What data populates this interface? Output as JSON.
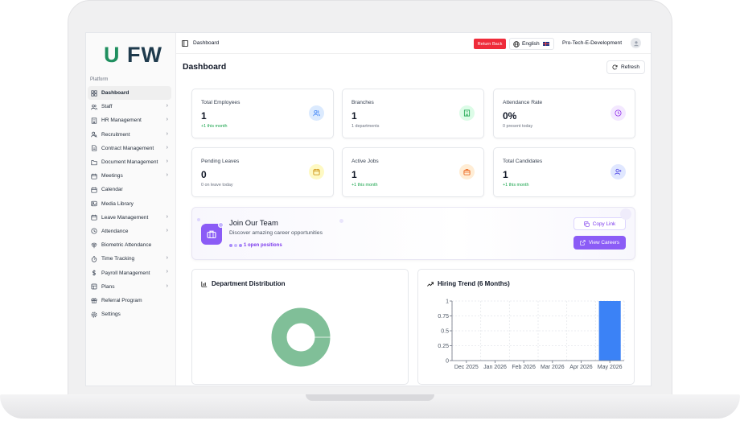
{
  "sidebar": {
    "logo_u": "U",
    "logo_fw": "FW",
    "section_label": "Platform",
    "items": [
      {
        "label": "Dashboard",
        "icon": "grid-icon",
        "chevron": false
      },
      {
        "label": "Staff",
        "icon": "users-icon",
        "chevron": true
      },
      {
        "label": "HR Management",
        "icon": "building-icon",
        "chevron": true
      },
      {
        "label": "Recruitment",
        "icon": "user-search-icon",
        "chevron": true
      },
      {
        "label": "Contract Management",
        "icon": "file-icon",
        "chevron": true
      },
      {
        "label": "Document Management",
        "icon": "folder-icon",
        "chevron": true
      },
      {
        "label": "Meetings",
        "icon": "calendar-icon",
        "chevron": true
      },
      {
        "label": "Calendar",
        "icon": "calendar-icon",
        "chevron": false
      },
      {
        "label": "Media Library",
        "icon": "image-icon",
        "chevron": false
      },
      {
        "label": "Leave Management",
        "icon": "calendar-icon",
        "chevron": true
      },
      {
        "label": "Attendance",
        "icon": "clock-icon",
        "chevron": true
      },
      {
        "label": "Biometric Attendance",
        "icon": "fingerprint-icon",
        "chevron": false
      },
      {
        "label": "Time Tracking",
        "icon": "timer-icon",
        "chevron": true
      },
      {
        "label": "Payroll Management",
        "icon": "dollar-icon",
        "chevron": true
      },
      {
        "label": "Plans",
        "icon": "layers-icon",
        "chevron": true
      },
      {
        "label": "Referral Program",
        "icon": "gift-icon",
        "chevron": false
      },
      {
        "label": "Settings",
        "icon": "gear-icon",
        "chevron": false
      }
    ]
  },
  "topbar": {
    "breadcrumb": "Dashboard",
    "return_back": "Return Back",
    "language": "English",
    "user_name": "Pro-Tech-E-Development"
  },
  "page": {
    "title": "Dashboard",
    "refresh_label": "Refresh"
  },
  "stats": [
    {
      "label": "Total Employees",
      "value": "1",
      "sub": "+1 this month",
      "sub_color": "green",
      "icon": "users-icon",
      "icon_bg": "#dbeafe",
      "icon_color": "#3b82f6"
    },
    {
      "label": "Branches",
      "value": "1",
      "sub": "1 departments",
      "sub_color": "gray",
      "icon": "building-icon",
      "icon_bg": "#dcfce7",
      "icon_color": "#16a34a"
    },
    {
      "label": "Attendance Rate",
      "value": "0%",
      "sub": "0 present today",
      "sub_color": "gray",
      "icon": "clock-icon",
      "icon_bg": "#f3e8ff",
      "icon_color": "#9333ea"
    },
    {
      "label": "Pending Leaves",
      "value": "0",
      "sub": "0 on leave today",
      "sub_color": "gray",
      "icon": "calendar-icon",
      "icon_bg": "#fef9c3",
      "icon_color": "#ca8a04"
    },
    {
      "label": "Active Jobs",
      "value": "1",
      "sub": "+1 this month",
      "sub_color": "green",
      "icon": "briefcase-icon",
      "icon_bg": "#ffedd5",
      "icon_color": "#ea580c"
    },
    {
      "label": "Total Candidates",
      "value": "1",
      "sub": "+1 this month",
      "sub_color": "green",
      "icon": "user-plus-icon",
      "icon_bg": "#e0e7ff",
      "icon_color": "#4f46e5"
    }
  ],
  "join": {
    "title": "Join Our Team",
    "description": "Discover amazing career opportunities",
    "open_positions": "1 open positions",
    "copy_link": "Copy Link",
    "view_careers": "View Careers"
  },
  "chart_data": [
    {
      "type": "pie",
      "title": "Department Distribution",
      "values": [
        1
      ],
      "colors": [
        "#80bf98"
      ],
      "donut": true
    },
    {
      "type": "bar",
      "title": "Hiring Trend (6 Months)",
      "categories": [
        "Dec 2025",
        "Jan 2026",
        "Feb 2026",
        "Mar 2026",
        "Apr 2026",
        "May 2026"
      ],
      "values": [
        0,
        0,
        0,
        0,
        0,
        1
      ],
      "ylim": [
        0,
        1
      ],
      "yticks": [
        "0",
        "0.25",
        "0.5",
        "0.75",
        "1"
      ],
      "color": "#3b82f6",
      "grid": true
    }
  ]
}
